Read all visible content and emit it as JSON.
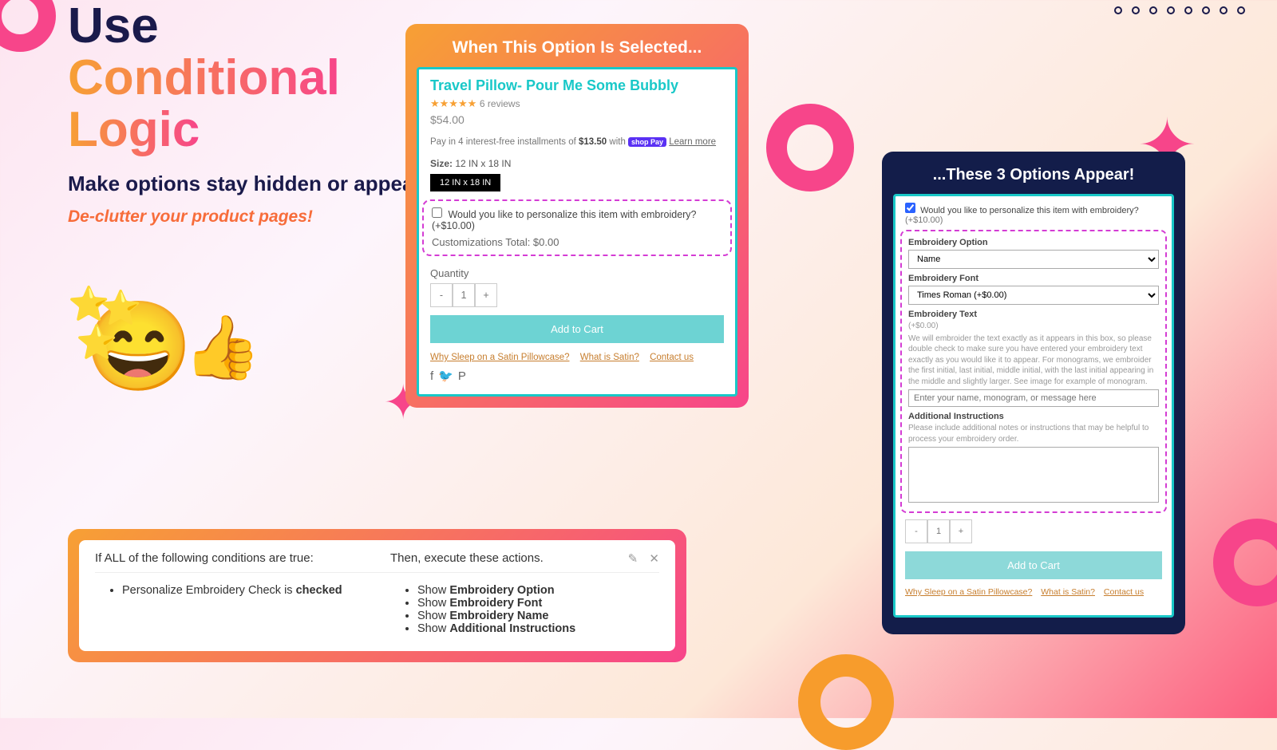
{
  "headline": {
    "line1": "Use",
    "line2": "Conditional",
    "line3": "Logic",
    "subtitle": "Make options stay hidden or appear as needed",
    "tagline": "De-clutter your product pages!"
  },
  "card1": {
    "title": "When This Option Is Selected...",
    "product": {
      "name": "Travel Pillow- Pour Me Some Bubbly",
      "stars": "★★★★★",
      "reviews": "6 reviews",
      "price": "$54.00",
      "install_pre": "Pay in 4 interest-free installments of ",
      "install_amt": "$13.50",
      "install_post": " with ",
      "shoppay": "shop Pay",
      "learn": "Learn more",
      "size_label": "Size:",
      "size_value": "12 IN x 18 IN",
      "size_button": "12 IN x 18 IN",
      "personalize_label": "Would you like to personalize this item with embroidery?",
      "personalize_price": "(+$10.00)",
      "customizations_total": "Customizations Total: $0.00",
      "qty_label": "Quantity",
      "qty_value": "1",
      "add_to_cart": "Add to Cart",
      "link1": "Why Sleep on a Satin Pillowcase?",
      "link2": "What is Satin?",
      "link3": "Contact us"
    }
  },
  "card2": {
    "title": "...These 3 Options Appear!",
    "personalize_label": "Would you like to personalize this item with embroidery?",
    "personalize_price": "(+$10.00)",
    "opt1_label": "Embroidery Option",
    "opt1_value": "Name",
    "opt2_label": "Embroidery Font",
    "opt2_value": "Times Roman (+$0.00)",
    "opt3_label": "Embroidery Text",
    "opt3_price": "(+$0.00)",
    "opt3_desc": "We will embroider the text exactly as it appears in this box, so please double check to make sure you have entered your embroidery text exactly as you would like it to appear. For monograms, we embroider the first initial, last initial, middle initial, with the last initial appearing in the middle and slightly larger. See image for example of monogram.",
    "opt3_placeholder": "Enter your name, monogram, or message here",
    "opt4_label": "Additional Instructions",
    "opt4_desc": "Please include additional notes or instructions that may be helpful to process your embroidery order.",
    "qty_value": "1",
    "add_to_cart": "Add to Cart",
    "link1": "Why Sleep on a Satin Pillowcase?",
    "link2": "What is Satin?",
    "link3": "Contact us"
  },
  "rules": {
    "if_label": "If ALL of the following conditions are true:",
    "then_label": "Then, execute these actions.",
    "condition_pre": "Personalize Embroidery Check is ",
    "condition_state": "checked",
    "actions": [
      {
        "pre": "Show ",
        "b": "Embroidery Option"
      },
      {
        "pre": "Show ",
        "b": "Embroidery Font"
      },
      {
        "pre": "Show ",
        "b": "Embroidery Name"
      },
      {
        "pre": "Show ",
        "b": "Additional Instructions"
      }
    ]
  }
}
